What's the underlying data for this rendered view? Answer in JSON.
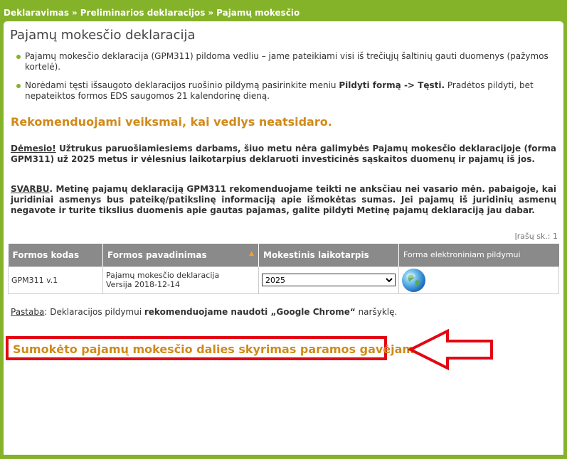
{
  "breadcrumb": [
    "Deklaravimas",
    "Preliminarios deklaracijos",
    "Pajamų mokesčio"
  ],
  "breadcrumb_sep": "»",
  "page_title": "Pajamų mokesčio deklaracija",
  "bullets": [
    "Pajamų mokesčio deklaracija (GPM311) pildoma vedliu – jame pateikiami visi iš trečiųjų šaltinių gauti duomenys (pažymos kortelė).",
    {
      "pre": "Norėdami tęsti išsaugoto deklaracijos ruošinio pildymą pasirinkite meniu ",
      "bold": "Pildyti formą -> Tęsti.",
      "post": " Pradėtos pildyti, bet nepateiktos formos EDS saugomos 21 kalendorinę dieną."
    }
  ],
  "recommend_title": "Rekomenduojami veiksmai, kai vedlys neatsidaro.",
  "warning": {
    "label": "Dėmesio!",
    "text": " Užtrukus paruošiamiesiems darbams, šiuo metu nėra galimybės Pajamų mokesčio deklaracijoje (forma GPM311) už 2025 metus ir vėlesnius laikotarpius deklaruoti investicinės sąskaitos duomenų ir pajamų iš jos."
  },
  "important": {
    "label": "SVARBU",
    "text": ". Metinę pajamų deklaraciją GPM311 rekomenduojame teikti ne anksčiau nei vasario mėn. pabaigoje, kai juridiniai asmenys bus pateikę/patikslinę informaciją apie išmokėtas sumas. Jei pajamų iš juridinių asmenų negavote ir turite tikslius duomenis apie gautas pajamas, galite pildyti Metinę pajamų deklaraciją jau dabar."
  },
  "records_count": "Įrašų sk.: 1",
  "table": {
    "headers": [
      "Formos kodas",
      "Formos pavadinimas",
      "Mokestinis laikotarpis",
      "Forma elektroniniam pildymui"
    ],
    "sort_indicator": "▲",
    "row": {
      "code": "GPM311 v.1",
      "name": "Pajamų mokesčio deklaracija",
      "version": "Versija 2018-12-14",
      "period": "2025"
    }
  },
  "note": {
    "label": "Pastaba",
    "pre": ": Deklaracijos pildymui ",
    "bold": "rekomenduojame naudoti „Google Chrome“",
    "post": " naršyklę."
  },
  "highlight_text": "Sumokėto pajamų mokesčio dalies skyrimas paramos gavėjams.",
  "colors": {
    "brand_green": "#84b229",
    "accent_orange": "#d08a1a",
    "highlight_red": "#e30613",
    "header_gray": "#8a8a8a"
  },
  "icons": [
    "globe-icon",
    "arrow-left-icon"
  ]
}
